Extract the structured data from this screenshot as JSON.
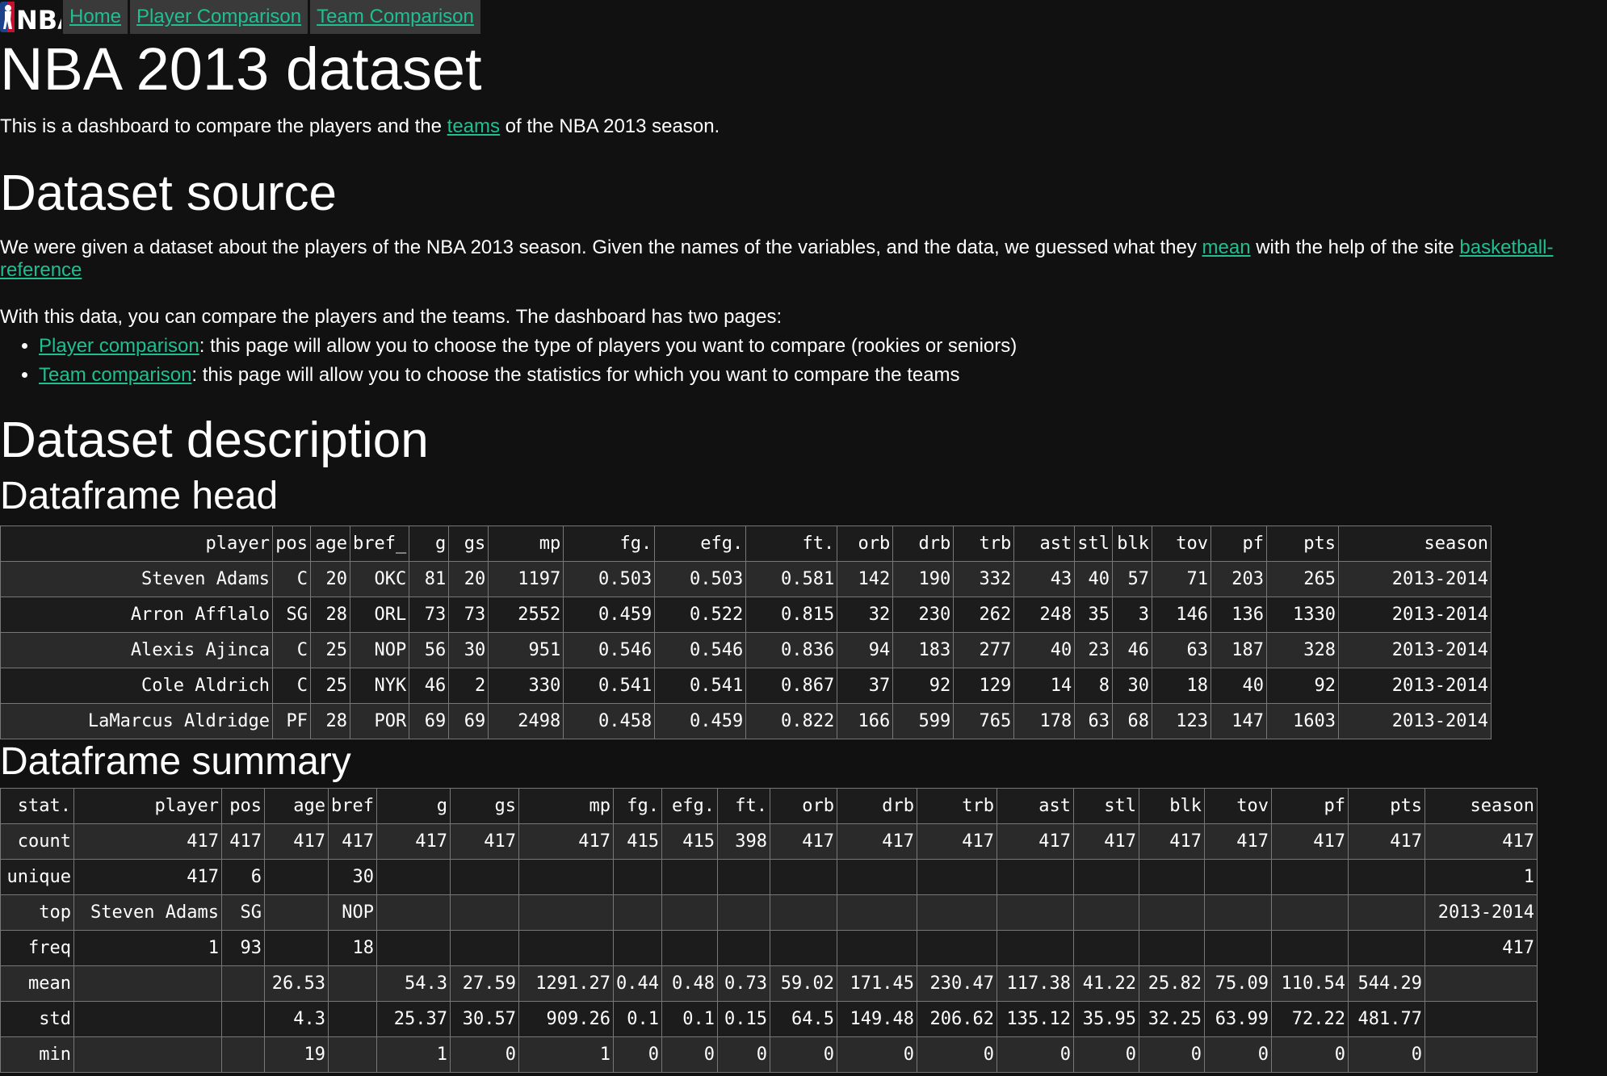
{
  "nav": {
    "logo_text": "NBA",
    "items": [
      {
        "label": "Home"
      },
      {
        "label": "Player Comparison"
      },
      {
        "label": "Team Comparison"
      }
    ]
  },
  "page": {
    "title": "NBA 2013 dataset",
    "intro_before": "This is a dashboard to compare the players and the ",
    "intro_link": "teams",
    "intro_after": " of the NBA 2013 season."
  },
  "source": {
    "heading": "Dataset source",
    "p1_before": "We were given a dataset about the players of the NBA 2013 season. Given the names of the variables, and the data, we guessed what they ",
    "p1_link1": "mean",
    "p1_mid": " with the help of the site ",
    "p1_link2": "basketball-reference",
    "p2": "With this data, you can compare the players and the teams. The dashboard has two pages:",
    "list": [
      {
        "link": "Player comparison",
        "text": ": this page will allow you to choose the type of players you want to compare (rookies or seniors)"
      },
      {
        "link": "Team comparison",
        "text": ": this page will allow you to choose the statistics for which you want to compare the teams"
      }
    ]
  },
  "description": {
    "heading": "Dataset description",
    "head_heading": "Dataframe head",
    "summary_heading": "Dataframe summary"
  },
  "head_table": {
    "columns": [
      "player",
      "pos",
      "age",
      "bref_",
      "g",
      "gs",
      "mp",
      "fg.",
      "efg.",
      "ft.",
      "orb",
      "drb",
      "trb",
      "ast",
      "stl",
      "blk",
      "tov",
      "pf",
      "pts",
      "season"
    ],
    "rows": [
      [
        "Steven Adams",
        "C",
        "20",
        "OKC",
        "81",
        "20",
        "1197",
        "0.503",
        "0.503",
        "0.581",
        "142",
        "190",
        "332",
        "43",
        "40",
        "57",
        "71",
        "203",
        "265",
        "2013-2014"
      ],
      [
        "Arron Afflalo",
        "SG",
        "28",
        "ORL",
        "73",
        "73",
        "2552",
        "0.459",
        "0.522",
        "0.815",
        "32",
        "230",
        "262",
        "248",
        "35",
        "3",
        "146",
        "136",
        "1330",
        "2013-2014"
      ],
      [
        "Alexis Ajinca",
        "C",
        "25",
        "NOP",
        "56",
        "30",
        "951",
        "0.546",
        "0.546",
        "0.836",
        "94",
        "183",
        "277",
        "40",
        "23",
        "46",
        "63",
        "187",
        "328",
        "2013-2014"
      ],
      [
        "Cole Aldrich",
        "C",
        "25",
        "NYK",
        "46",
        "2",
        "330",
        "0.541",
        "0.541",
        "0.867",
        "37",
        "92",
        "129",
        "14",
        "8",
        "30",
        "18",
        "40",
        "92",
        "2013-2014"
      ],
      [
        "LaMarcus Aldridge",
        "PF",
        "28",
        "POR",
        "69",
        "69",
        "2498",
        "0.458",
        "0.459",
        "0.822",
        "166",
        "599",
        "765",
        "178",
        "63",
        "68",
        "123",
        "147",
        "1603",
        "2013-2014"
      ]
    ]
  },
  "summary_table": {
    "columns": [
      "stat.",
      "player",
      "pos",
      "age",
      "bref",
      "g",
      "gs",
      "mp",
      "fg.",
      "efg.",
      "ft.",
      "orb",
      "drb",
      "trb",
      "ast",
      "stl",
      "blk",
      "tov",
      "pf",
      "pts",
      "season"
    ],
    "rows": [
      [
        "count",
        "417",
        "417",
        "417",
        "417",
        "417",
        "417",
        "417",
        "415",
        "415",
        "398",
        "417",
        "417",
        "417",
        "417",
        "417",
        "417",
        "417",
        "417",
        "417",
        "417"
      ],
      [
        "unique",
        "417",
        "6",
        "",
        "30",
        "",
        "",
        "",
        "",
        "",
        "",
        "",
        "",
        "",
        "",
        "",
        "",
        "",
        "",
        "",
        "1"
      ],
      [
        "top",
        "Steven Adams",
        "SG",
        "",
        "NOP",
        "",
        "",
        "",
        "",
        "",
        "",
        "",
        "",
        "",
        "",
        "",
        "",
        "",
        "",
        "",
        "2013-2014"
      ],
      [
        "freq",
        "1",
        "93",
        "",
        "18",
        "",
        "",
        "",
        "",
        "",
        "",
        "",
        "",
        "",
        "",
        "",
        "",
        "",
        "",
        "",
        "417"
      ],
      [
        "mean",
        "",
        "",
        "26.53",
        "",
        "54.3",
        "27.59",
        "1291.27",
        "0.44",
        "0.48",
        "0.73",
        "59.02",
        "171.45",
        "230.47",
        "117.38",
        "41.22",
        "25.82",
        "75.09",
        "110.54",
        "544.29",
        ""
      ],
      [
        "std",
        "",
        "",
        "4.3",
        "",
        "25.37",
        "30.57",
        "909.26",
        "0.1",
        "0.1",
        "0.15",
        "64.5",
        "149.48",
        "206.62",
        "135.12",
        "35.95",
        "32.25",
        "63.99",
        "72.22",
        "481.77",
        ""
      ],
      [
        "min",
        "",
        "",
        "19",
        "",
        "1",
        "0",
        "1",
        "0",
        "0",
        "0",
        "0",
        "0",
        "0",
        "0",
        "0",
        "0",
        "0",
        "0",
        "0",
        ""
      ]
    ]
  }
}
